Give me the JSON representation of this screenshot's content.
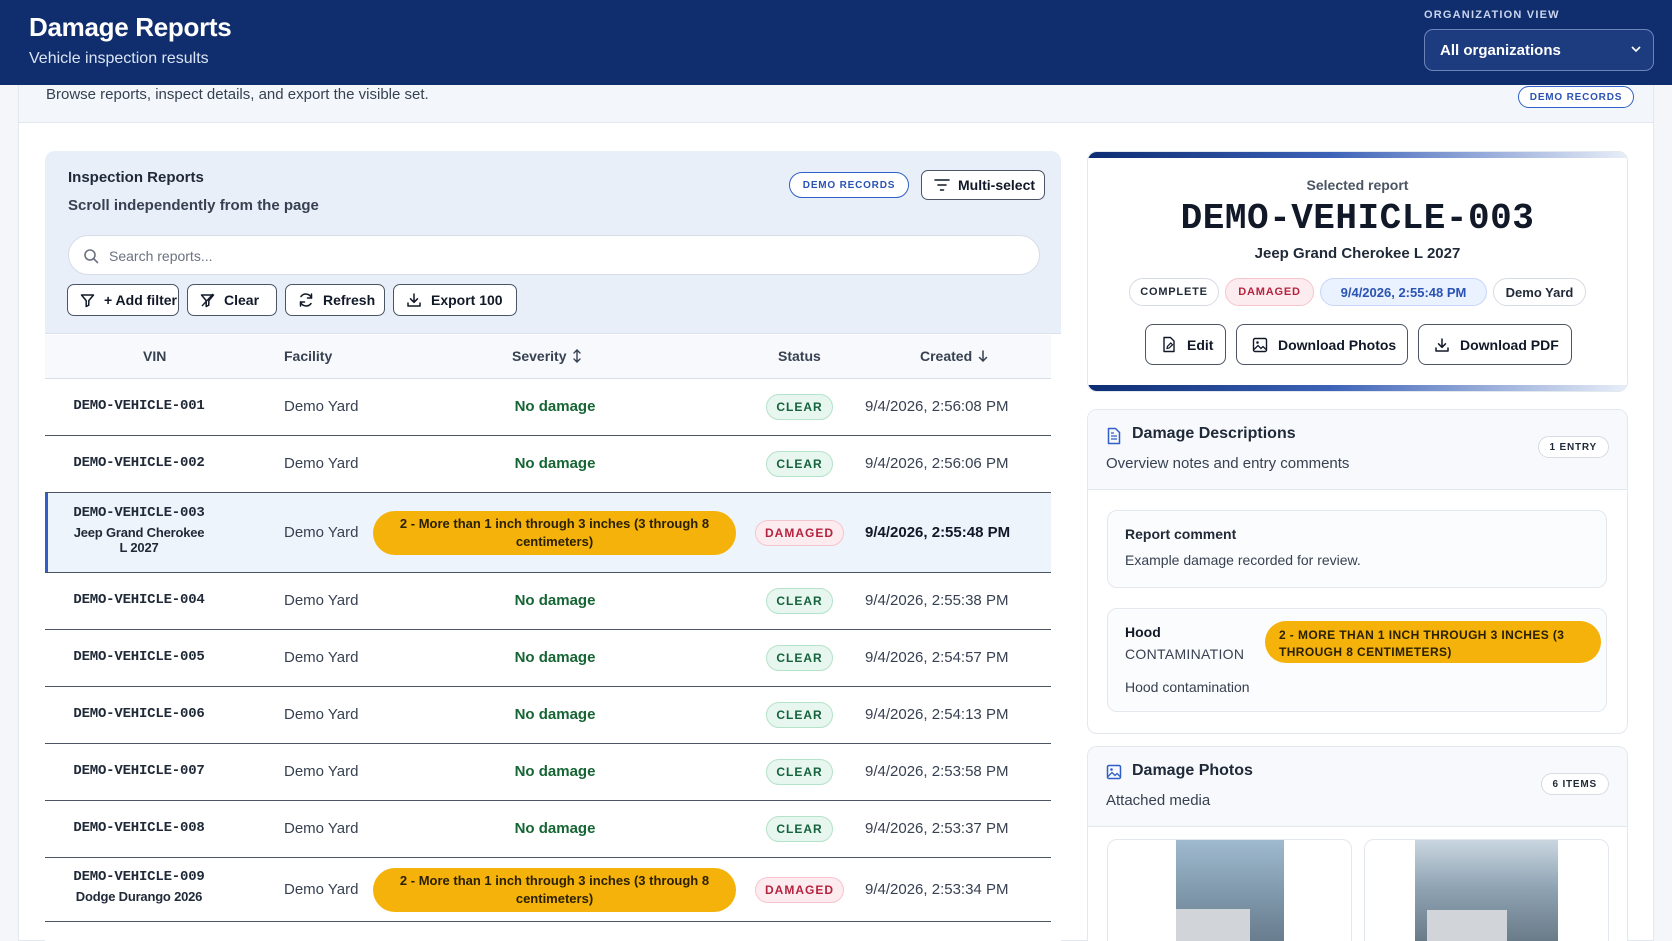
{
  "header": {
    "title": "Damage Reports",
    "subtitle": "Vehicle inspection results",
    "org_label": "ORGANIZATION VIEW",
    "org_value": "All organizations"
  },
  "infobar": {
    "text": "Browse reports, inspect details, and export the visible set.",
    "badge": "DEMO RECORDS"
  },
  "reports_panel": {
    "title": "Inspection Reports",
    "subtitle": "Scroll independently from the page",
    "badge": "DEMO RECORDS",
    "multiselect_label": "Multi-select",
    "search_placeholder": "Search reports...",
    "search_value": "",
    "toolbar": {
      "add_filter": "+ Add filter",
      "clear": "Clear",
      "refresh": "Refresh",
      "export": "Export 100"
    },
    "columns": [
      "VIN",
      "Facility",
      "Severity",
      "Status",
      "Created"
    ],
    "rows": [
      {
        "vin": "DEMO-VEHICLE-001",
        "model": "",
        "facility": "Demo Yard",
        "severity": "No damage",
        "status": "CLEAR",
        "created": "9/4/2026, 2:56:08 PM"
      },
      {
        "vin": "DEMO-VEHICLE-002",
        "model": "",
        "facility": "Demo Yard",
        "severity": "No damage",
        "status": "CLEAR",
        "created": "9/4/2026, 2:56:06 PM"
      },
      {
        "vin": "DEMO-VEHICLE-003",
        "model": "Jeep Grand Cherokee L 2027",
        "facility": "Demo Yard",
        "severity": "2 - More than 1 inch through 3 inches (3 through 8 centimeters)",
        "status": "DAMAGED",
        "created": "9/4/2026, 2:55:48 PM"
      },
      {
        "vin": "DEMO-VEHICLE-004",
        "model": "",
        "facility": "Demo Yard",
        "severity": "No damage",
        "status": "CLEAR",
        "created": "9/4/2026, 2:55:38 PM"
      },
      {
        "vin": "DEMO-VEHICLE-005",
        "model": "",
        "facility": "Demo Yard",
        "severity": "No damage",
        "status": "CLEAR",
        "created": "9/4/2026, 2:54:57 PM"
      },
      {
        "vin": "DEMO-VEHICLE-006",
        "model": "",
        "facility": "Demo Yard",
        "severity": "No damage",
        "status": "CLEAR",
        "created": "9/4/2026, 2:54:13 PM"
      },
      {
        "vin": "DEMO-VEHICLE-007",
        "model": "",
        "facility": "Demo Yard",
        "severity": "No damage",
        "status": "CLEAR",
        "created": "9/4/2026, 2:53:58 PM"
      },
      {
        "vin": "DEMO-VEHICLE-008",
        "model": "",
        "facility": "Demo Yard",
        "severity": "No damage",
        "status": "CLEAR",
        "created": "9/4/2026, 2:53:37 PM"
      },
      {
        "vin": "DEMO-VEHICLE-009",
        "model": "Dodge Durango 2026",
        "facility": "Demo Yard",
        "severity": "2 - More than 1 inch through 3 inches (3 through 8 centimeters)",
        "status": "DAMAGED",
        "created": "9/4/2026, 2:53:34 PM"
      }
    ]
  },
  "selected": {
    "label": "Selected report",
    "vin": "DEMO-VEHICLE-003",
    "model": "Jeep Grand Cherokee L 2027",
    "chips": [
      "COMPLETE",
      "DAMAGED",
      "9/4/2026, 2:55:48 PM",
      "Demo Yard"
    ],
    "actions": {
      "edit": "Edit",
      "photos": "Download Photos",
      "pdf": "Download PDF"
    }
  },
  "descriptions": {
    "title": "Damage Descriptions",
    "subtitle": "Overview notes and entry comments",
    "count": "1 ENTRY",
    "report_comment_title": "Report comment",
    "report_comment_text": "Example damage recorded for review.",
    "entry": {
      "part": "Hood",
      "type": "CONTAMINATION",
      "severity": "2 - MORE THAN 1 INCH THROUGH 3 INCHES (3 THROUGH 8 CENTIMETERS)",
      "description": "Hood contamination"
    }
  },
  "photos": {
    "title": "Damage Photos",
    "subtitle": "Attached media",
    "count": "6 ITEMS"
  },
  "colors": {
    "header_bg": "#102e6e",
    "accent": "#2f5fc7",
    "severity_pill": "#f5b20a",
    "clear_text": "#15633c",
    "damaged_text": "#b4233f"
  }
}
